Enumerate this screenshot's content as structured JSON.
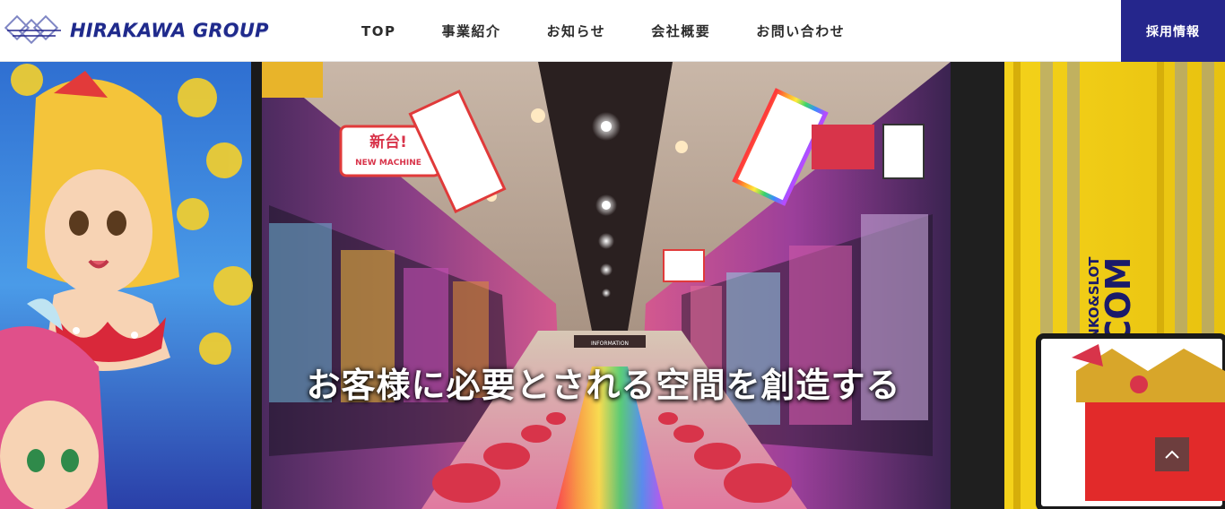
{
  "header": {
    "logo_text": "HIRAKAWA GROUP",
    "nav": [
      {
        "label": "TOP"
      },
      {
        "label": "事業紹介"
      },
      {
        "label": "お知らせ"
      },
      {
        "label": "会社概要"
      },
      {
        "label": "お問い合わせ"
      }
    ],
    "recruit_label": "採用情報"
  },
  "hero": {
    "catchphrase": "お客様に必要とされる空間を創造する",
    "signage": {
      "new_machine_jp": "新台!",
      "new_machine_en": "NEW MACHINE",
      "information": "INFORMATION",
      "pachinko_slot": "PACHINKO&SLOT",
      "dotcom": ".COM"
    }
  },
  "colors": {
    "brand_navy": "#25268c",
    "logo_navy": "#1f2a8c",
    "nav_text": "#2b2b2b"
  },
  "icons": {
    "logo_mark": "hirakawa-logo-mark-icon",
    "back_to_top": "chevron-up-icon"
  }
}
